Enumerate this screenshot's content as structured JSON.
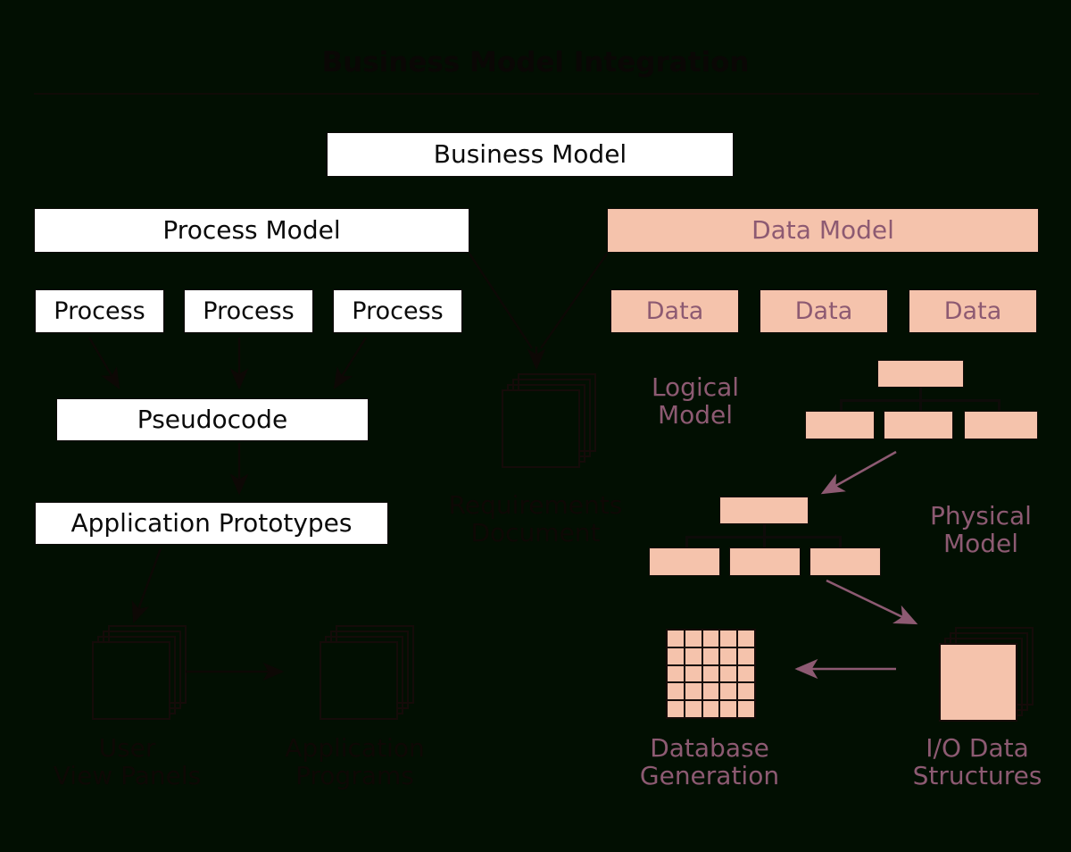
{
  "title": "Business Model Integration",
  "colors": {
    "background": "#020f02",
    "salmon_fill": "#f5c3ac",
    "mauve_text": "#8d5a72",
    "dark_ink": "#0e0805",
    "white_fill": "#ffffff",
    "arrow_mauve": "#8d5a72",
    "arrow_dark": "#0d0805"
  },
  "nodes": {
    "business_model": "Business Model",
    "process_model": "Process Model",
    "data_model": "Data Model",
    "process_boxes": [
      "Process",
      "Process",
      "Process"
    ],
    "data_boxes": [
      "Data",
      "Data",
      "Data"
    ],
    "pseudocode": "Pseudocode",
    "application_prototypes": "Application Prototypes"
  },
  "labels": {
    "requirements_document": "Requirements\nDocument",
    "user_view_panels": "User\nView Panels",
    "application_programs": "Application\nPrograms",
    "logical_model": "Logical\nModel",
    "physical_model": "Physical\nModel",
    "database_generation": "Database\nGeneration",
    "io_data_structures": "I/O Data\nStructures"
  },
  "chart_data": {
    "type": "diagram",
    "title": "Business Model Integration",
    "description": "Hierarchical decomposition of a business model into a process model branch and a data model branch, converging on a requirements document and flowing to implementation artifacts.",
    "branches": [
      {
        "name": "Process Model",
        "style": "white",
        "children": [
          "Process",
          "Process",
          "Process"
        ],
        "flow": [
          "Pseudocode",
          "Application Prototypes",
          "User View Panels",
          "Application Programs"
        ]
      },
      {
        "name": "Data Model",
        "style": "salmon",
        "children": [
          "Data",
          "Data",
          "Data"
        ],
        "flow": [
          "Logical Model",
          "Physical Model",
          "I/O Data Structures",
          "Database Generation"
        ]
      }
    ],
    "shared_artifact": "Requirements Document",
    "database_grid": {
      "rows": 5,
      "cols": 5
    },
    "document_stack_sheets": 4
  }
}
